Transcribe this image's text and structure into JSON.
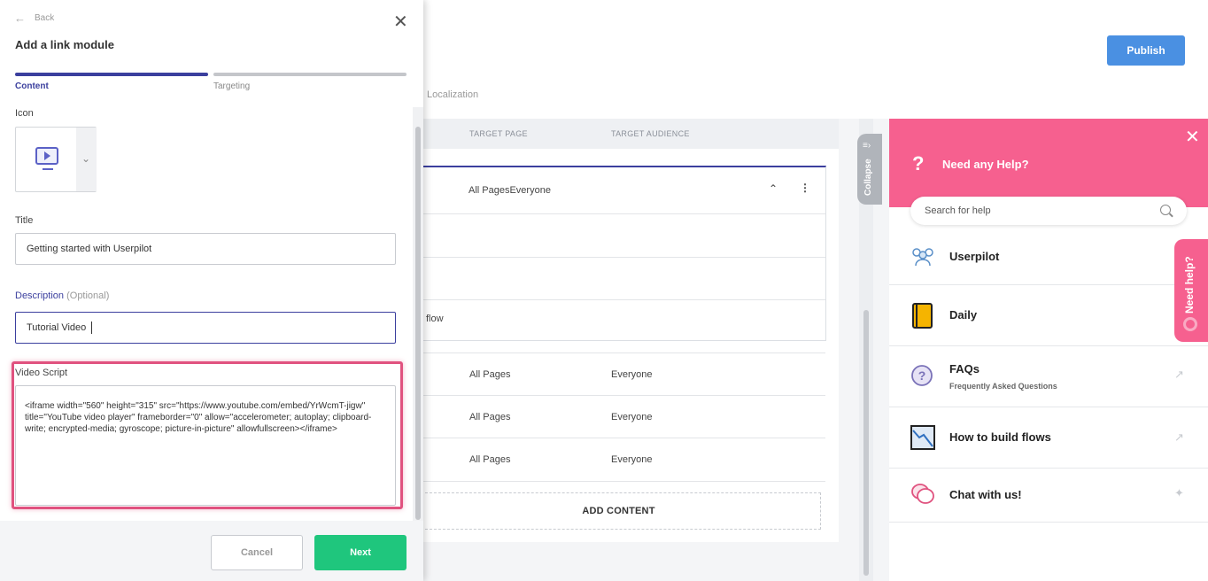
{
  "app": {
    "publish_label": "Publish",
    "localization_tab": "Localization"
  },
  "table": {
    "columns": [
      "TARGET PAGE",
      "TARGET AUDIENCE"
    ],
    "expanded_row": {
      "target": "All PagesEveryone",
      "sub_item_fragment": "flow"
    },
    "rows": [
      {
        "page": "All Pages",
        "audience": "Everyone"
      },
      {
        "page": "All Pages",
        "audience": "Everyone"
      },
      {
        "page": "All Pages",
        "audience": "Everyone"
      }
    ],
    "add_content_label": "ADD CONTENT",
    "collapse_label": "Collapse"
  },
  "help": {
    "title": "Need any Help?",
    "search_placeholder": "Search for help",
    "items": [
      {
        "label": "Userpilot",
        "sub": ""
      },
      {
        "label": "Daily",
        "sub": ""
      },
      {
        "label": "FAQs",
        "sub": "Frequently Asked Questions"
      },
      {
        "label": "How to build flows",
        "sub": ""
      },
      {
        "label": "Chat with us!",
        "sub": ""
      }
    ],
    "need_help_tab": "Need help?",
    "colors": {
      "accent": "#f6608f"
    }
  },
  "modal": {
    "back_label": "Back",
    "title": "Add a link module",
    "steps": [
      {
        "label": "Content",
        "active": true
      },
      {
        "label": "Targeting",
        "active": false
      }
    ],
    "icon_label": "Icon",
    "title_label": "Title",
    "title_value": "Getting started with Userpilot",
    "description_label": "Description",
    "description_optional": "(Optional)",
    "description_value": "Tutorial Video",
    "video_script_label": "Video Script",
    "video_script_value": "<iframe width=\"560\" height=\"315\" src=\"https://www.youtube.com/embed/YrWcmT-jigw\" title=\"YouTube video player\" frameborder=\"0\" allow=\"accelerometer; autoplay; clipboard-write; encrypted-media; gyroscope; picture-in-picture\" allowfullscreen></iframe>",
    "cancel_label": "Cancel",
    "next_label": "Next",
    "colors": {
      "primary": "#3b3f9e",
      "next": "#1fc67d",
      "publish": "#4a90e2"
    }
  }
}
